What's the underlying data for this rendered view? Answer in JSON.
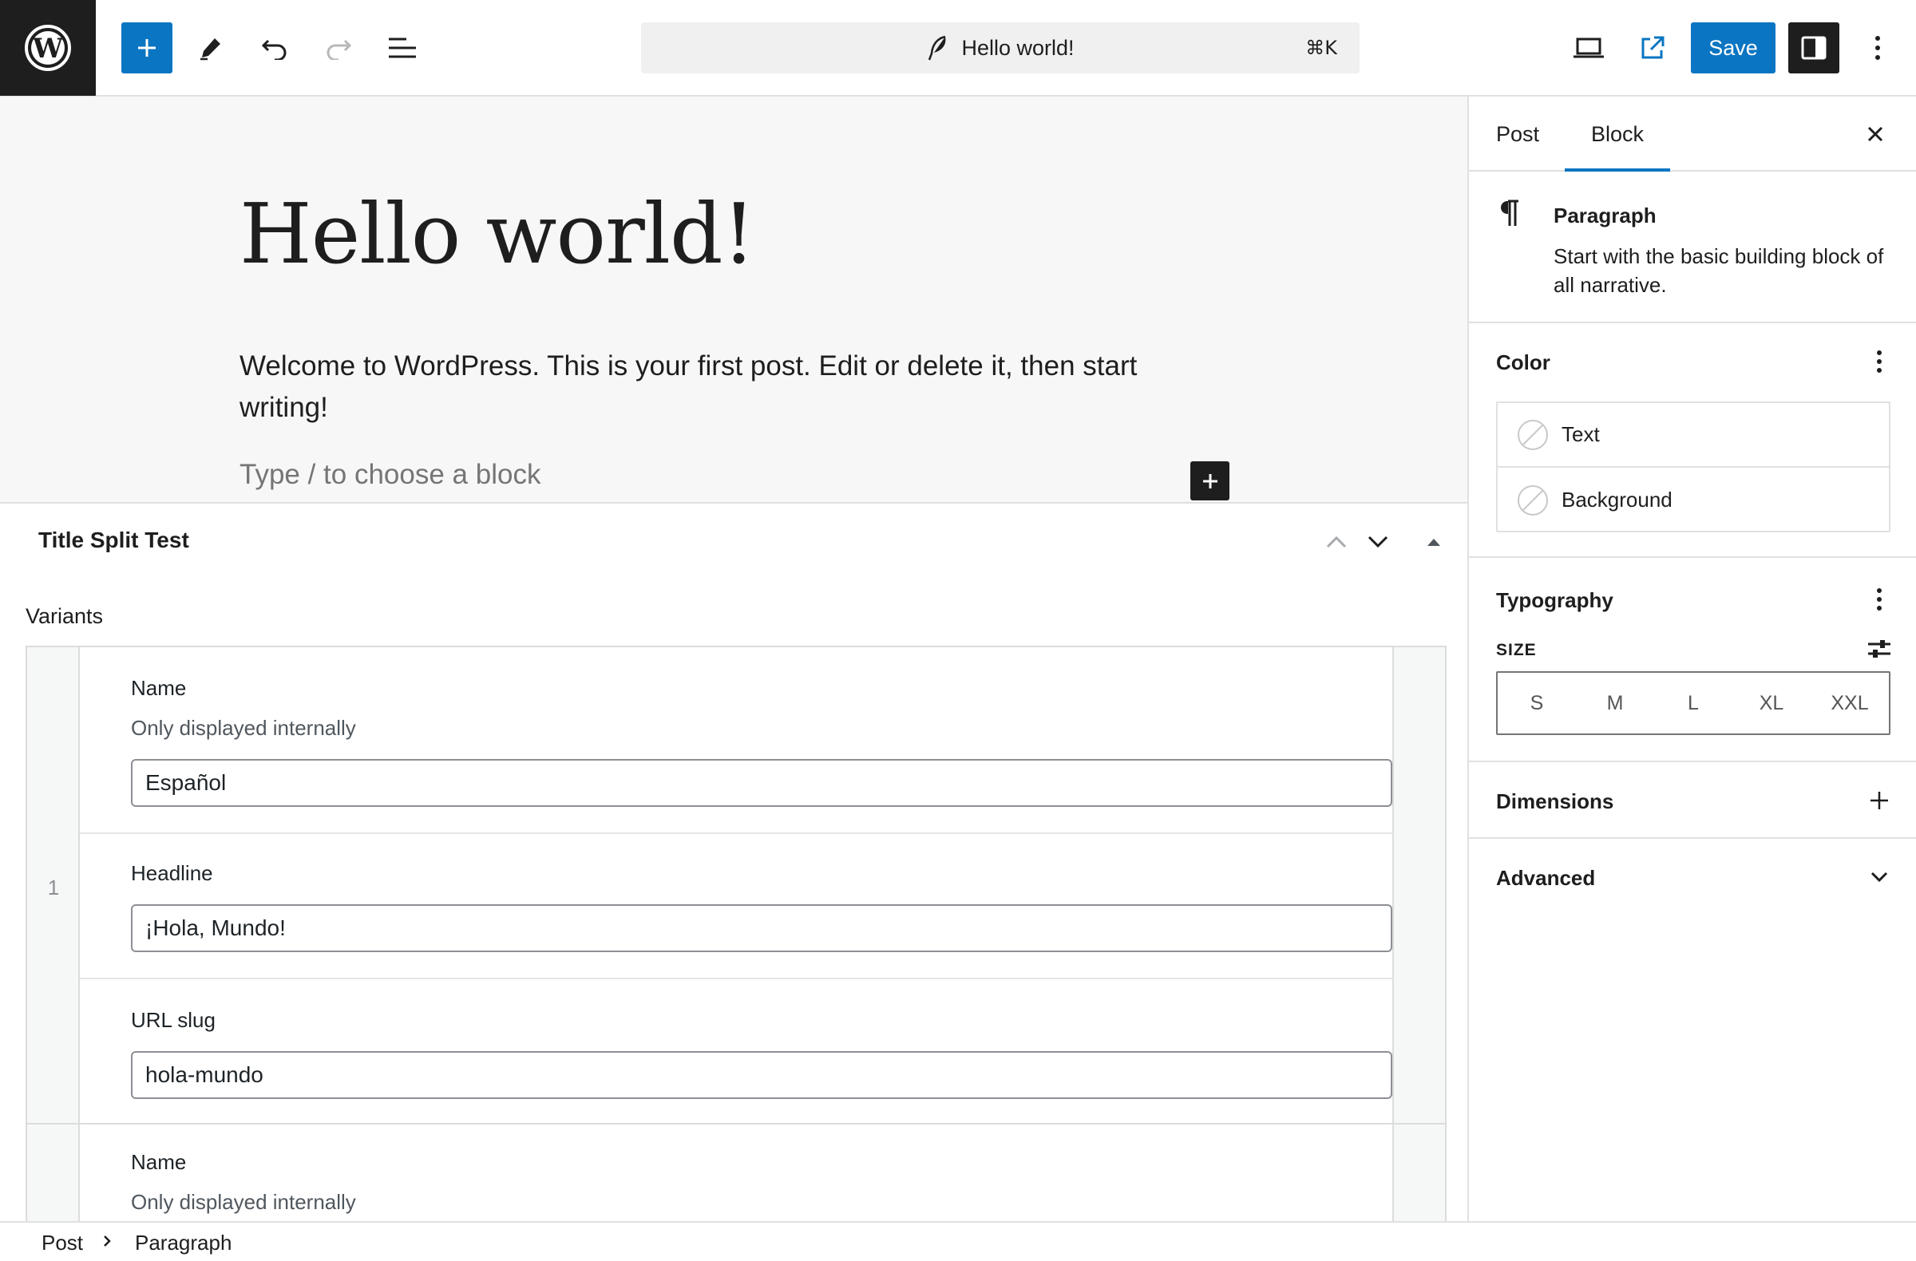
{
  "toolbar": {
    "logo_icon": "wordpress-logo",
    "add_block_icon": "plus-icon",
    "tools_icon": "pencil-icon",
    "undo_icon": "undo-icon",
    "redo_icon": "redo-icon",
    "list_view_icon": "list-view-icon",
    "command_bar": {
      "icon": "feather-icon",
      "title": "Hello world!",
      "shortcut": "⌘K"
    },
    "preview_icon": "laptop-icon",
    "view_post_icon": "external-link-icon",
    "save_label": "Save",
    "settings_icon": "sidebar-toggle-icon",
    "options_icon": "more-vertical-icon",
    "accent_color": "#0a75c2"
  },
  "editor": {
    "title": "Hello world!",
    "paragraph": "Welcome to WordPress. This is your first post. Edit or delete it, then start writing!",
    "placeholder": "Type / to choose a block"
  },
  "metabox": {
    "title": "Title Split Test",
    "variants_label": "Variants",
    "rows": [
      {
        "number": "1",
        "name_label": "Name",
        "name_description": "Only displayed internally",
        "name_value": "Español",
        "headline_label": "Headline",
        "headline_value": "¡Hola, Mundo!",
        "slug_label": "URL slug",
        "slug_value": "hola-mundo"
      },
      {
        "name_label": "Name",
        "name_description": "Only displayed internally"
      }
    ]
  },
  "sidebar": {
    "tabs": [
      {
        "label": "Post"
      },
      {
        "label": "Block",
        "active": true
      }
    ],
    "block_card": {
      "icon": "paragraph-icon",
      "name": "Paragraph",
      "description": "Start with the basic building block of all narrative."
    },
    "color": {
      "title": "Color",
      "items": [
        {
          "label": "Text"
        },
        {
          "label": "Background"
        }
      ]
    },
    "typography": {
      "title": "Typography",
      "size_label": "SIZE",
      "sizes": [
        "S",
        "M",
        "L",
        "XL",
        "XXL"
      ]
    },
    "dimensions": {
      "title": "Dimensions"
    },
    "advanced": {
      "title": "Advanced"
    }
  },
  "breadcrumb": {
    "items": [
      "Post",
      "Paragraph"
    ]
  }
}
